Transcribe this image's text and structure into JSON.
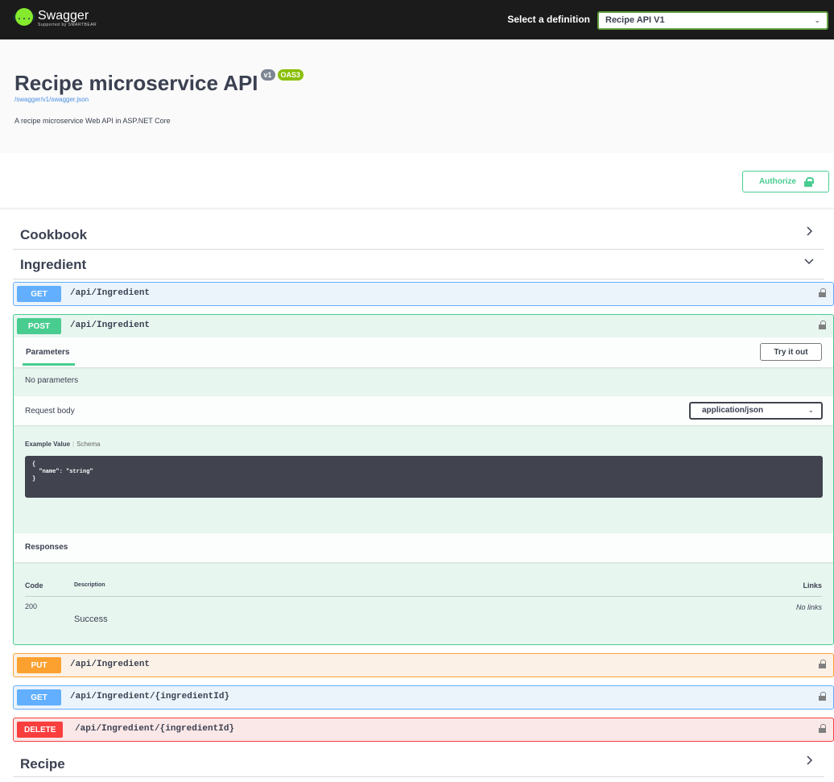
{
  "topbar": {
    "logo_glyph": "{...}",
    "logo_name": "Swagger",
    "logo_sub": "Supported by SMARTBEAR",
    "definition_label": "Select a definition",
    "definition_value": "Recipe API V1"
  },
  "info": {
    "title": "Recipe microservice API",
    "version_badge": "v1",
    "oas_badge": "OAS3",
    "spec_link": "/swagger/v1/swagger.json",
    "description": "A recipe microservice Web API in ASP.NET Core"
  },
  "authorize": {
    "label": "Authorize"
  },
  "tags": {
    "cookbook": "Cookbook",
    "ingredient": "Ingredient",
    "recipe": "Recipe"
  },
  "operations": [
    {
      "method": "GET",
      "path": "/api/Ingredient"
    },
    {
      "method": "POST",
      "path": "/api/Ingredient"
    },
    {
      "method": "PUT",
      "path": "/api/Ingredient"
    },
    {
      "method": "GET",
      "path": "/api/Ingredient/{ingredientId}"
    },
    {
      "method": "DELETE",
      "path": "/api/Ingredient/{ingredientId}"
    }
  ],
  "post_details": {
    "parameters_tab": "Parameters",
    "try_it_out": "Try it out",
    "no_parameters": "No parameters",
    "request_body_label": "Request body",
    "content_type": "application/json",
    "example_value_tab": "Example Value",
    "schema_tab": "Schema",
    "example_code": "{\n  \"name\": \"string\"\n}",
    "responses_title": "Responses",
    "col_code": "Code",
    "col_description": "Description",
    "col_links": "Links",
    "response_code": "200",
    "response_description": "Success",
    "response_links": "No links"
  },
  "colors": {
    "get": "#61affe",
    "post": "#49cc90",
    "put": "#fca130",
    "delete": "#f93e3e",
    "topbar": "#1b1b1b"
  }
}
